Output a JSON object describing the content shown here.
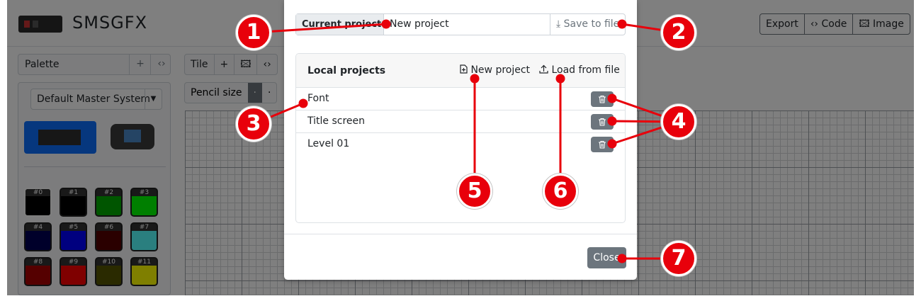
{
  "app": {
    "title": "SMSGFX",
    "toolbar": {
      "export_label": "Export",
      "code_label": "‹› Code",
      "image_label": "🖾 Image"
    },
    "palette": {
      "heading": "Palette",
      "add_label": "+",
      "code_label": "‹›",
      "selected_option": "Default Master System",
      "swatches": [
        {
          "label": "#0",
          "color": "#000000"
        },
        {
          "label": "#1",
          "color": "#000000"
        },
        {
          "label": "#2",
          "color": "#00aa00"
        },
        {
          "label": "#3",
          "color": "#00ff00"
        },
        {
          "label": "#4",
          "color": "#000055"
        },
        {
          "label": "#5",
          "color": "#0000ff"
        },
        {
          "label": "#6",
          "color": "#550000"
        },
        {
          "label": "#7",
          "color": "#55ffff"
        },
        {
          "label": "#8",
          "color": "#aa0000"
        },
        {
          "label": "#9",
          "color": "#ff0000"
        },
        {
          "label": "#10",
          "color": "#555500"
        },
        {
          "label": "#11",
          "color": "#ffff00"
        }
      ]
    },
    "tile": {
      "heading": "Tile",
      "add_label": "+",
      "image_label": "🖾",
      "code_label": "‹›"
    },
    "pencil": {
      "label": "Pencil size",
      "opt1": "·",
      "opt2": "·"
    }
  },
  "modal": {
    "current_project_label": "Current project",
    "project_name_value": "New project",
    "save_label": "⤓ Save to file",
    "local_projects_title": "Local projects",
    "new_project_label": "New project",
    "load_label": "Load from file",
    "projects": [
      {
        "name": "Font"
      },
      {
        "name": "Title screen"
      },
      {
        "name": "Level 01"
      }
    ],
    "close_label": "Close"
  },
  "callouts": [
    "1",
    "2",
    "3",
    "4",
    "5",
    "6",
    "7"
  ],
  "colors": {
    "callout_red": "#e8000b",
    "secondary": "#6c757d"
  }
}
